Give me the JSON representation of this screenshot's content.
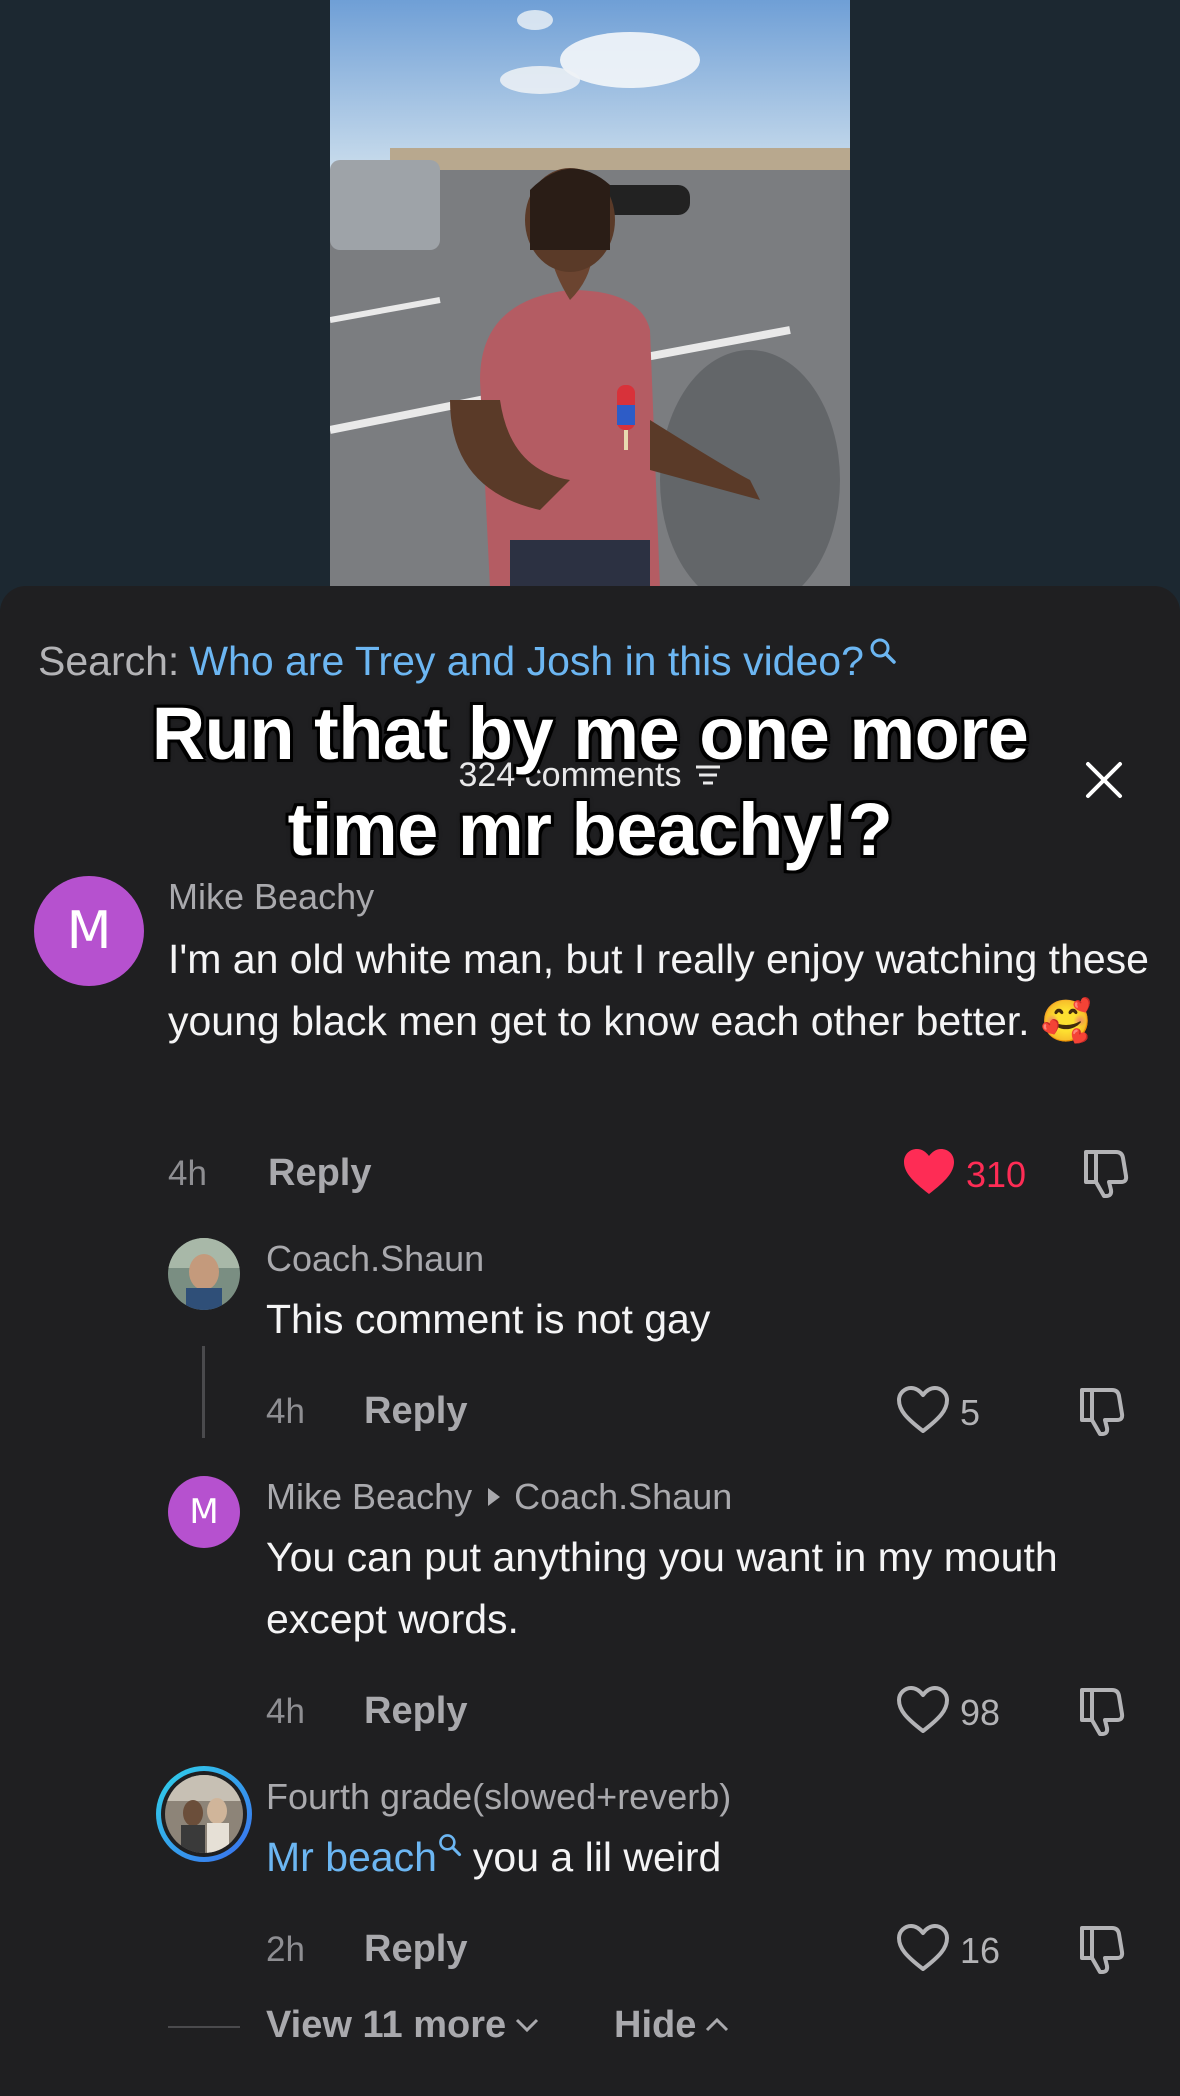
{
  "search": {
    "label": "Search:",
    "query": "Who are Trey and Josh in this video?"
  },
  "header": {
    "comment_count_label": "324 comments"
  },
  "overlay_caption": {
    "line1": "Run that by me one more",
    "line2": "time mr beachy!?"
  },
  "comments": [
    {
      "avatar_letter": "M",
      "username": "Mike Beachy",
      "text": "I'm an old white man, but I really enjoy watching these young black men get to know each other better. 🥰",
      "time": "4h",
      "reply_label": "Reply",
      "likes": "310",
      "liked": true
    },
    {
      "username": "Coach.Shaun",
      "text": "This comment is not gay",
      "time": "4h",
      "reply_label": "Reply",
      "likes": "5"
    },
    {
      "avatar_letter": "M",
      "username": "Mike Beachy",
      "reply_to": "Coach.Shaun",
      "text": "You can put anything you want in my mouth except words.",
      "time": "4h",
      "reply_label": "Reply",
      "likes": "98"
    },
    {
      "username": "Fourth grade(slowed+reverb)",
      "mention": "Mr beach",
      "text": "you a lil weird",
      "time": "2h",
      "reply_label": "Reply",
      "likes": "16"
    }
  ],
  "replies_footer": {
    "view_more_label": "View 11 more",
    "hide_label": "Hide"
  },
  "colors": {
    "accent_link": "#6cb6f2",
    "liked_heart": "#fe2c55",
    "avatar_purple": "#b651cf",
    "sheet_bg": "#1f1f21"
  }
}
